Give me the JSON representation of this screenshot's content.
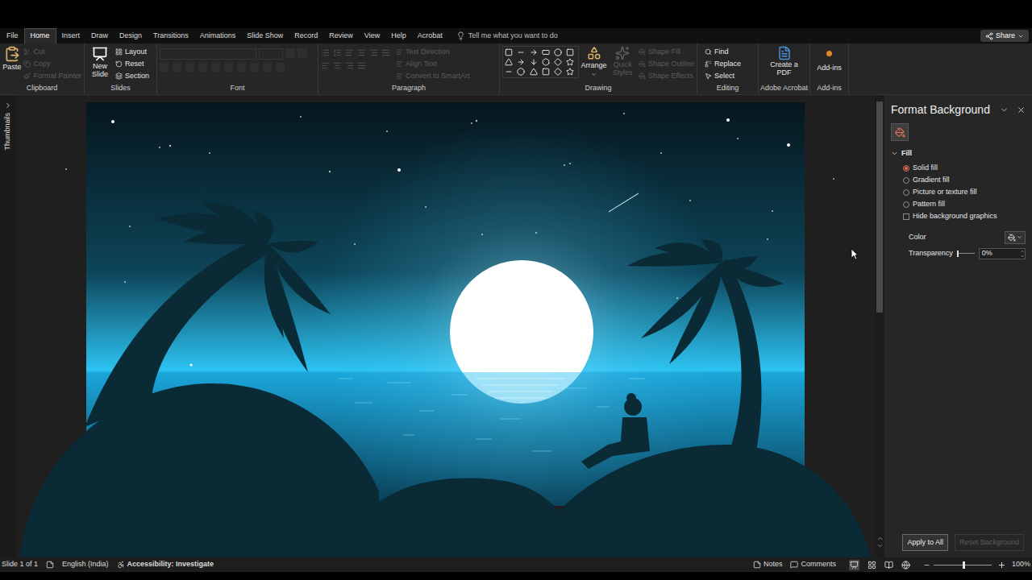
{
  "title_bar": {
    "share": "Share"
  },
  "tabs": [
    {
      "label": "File",
      "selected": false
    },
    {
      "label": "Home",
      "selected": true
    },
    {
      "label": "Insert",
      "selected": false
    },
    {
      "label": "Draw",
      "selected": false
    },
    {
      "label": "Design",
      "selected": false
    },
    {
      "label": "Transitions",
      "selected": false
    },
    {
      "label": "Animations",
      "selected": false
    },
    {
      "label": "Slide Show",
      "selected": false
    },
    {
      "label": "Record",
      "selected": false
    },
    {
      "label": "Review",
      "selected": false
    },
    {
      "label": "View",
      "selected": false
    },
    {
      "label": "Help",
      "selected": false
    },
    {
      "label": "Acrobat",
      "selected": false
    }
  ],
  "tell_me": "Tell me what you want to do",
  "ribbon": {
    "clipboard": {
      "label": "Clipboard",
      "paste": "Paste",
      "items": [
        {
          "label": "Cut",
          "disabled": true
        },
        {
          "label": "Copy",
          "disabled": true
        },
        {
          "label": "Format Painter",
          "disabled": true
        }
      ]
    },
    "slides": {
      "label": "Slides",
      "new_slide": "New Slide",
      "items": [
        "Layout",
        "Reset",
        "Section"
      ]
    },
    "font": {
      "label": "Font"
    },
    "paragraph": {
      "label": "Paragraph",
      "items": [
        {
          "label": "Text Direction",
          "disabled": true
        },
        {
          "label": "Align Text",
          "disabled": true
        },
        {
          "label": "Convert to SmartArt",
          "disabled": true
        }
      ]
    },
    "drawing": {
      "label": "Drawing",
      "arrange": "Arrange",
      "quick_styles": {
        "label": "Quick Styles",
        "disabled": true
      },
      "items": [
        {
          "label": "Shape Fill",
          "disabled": true
        },
        {
          "label": "Shape Outline",
          "disabled": true
        },
        {
          "label": "Shape Effects",
          "disabled": true
        }
      ]
    },
    "editing": {
      "label": "Editing",
      "items": [
        "Find",
        "Replace",
        "Select"
      ]
    },
    "acrobat": {
      "label": "Adobe Acrobat",
      "button": "Create a PDF"
    },
    "addins": {
      "label": "Add-ins",
      "button": "Add-ins"
    }
  },
  "thumbnails": {
    "label": "Thumbnails"
  },
  "pane": {
    "title": "Format Background",
    "section": "Fill",
    "expanded": true,
    "options": [
      {
        "label": "Solid fill",
        "selected": true
      },
      {
        "label": "Gradient fill",
        "selected": false
      },
      {
        "label": "Picture or texture fill",
        "selected": false
      },
      {
        "label": "Pattern fill",
        "selected": false
      }
    ],
    "hide_background_graphics": {
      "label": "Hide background graphics",
      "checked": false
    },
    "color": {
      "label": "Color"
    },
    "transparency": {
      "label": "Transparency",
      "value": "0%",
      "level": 0
    },
    "buttons": [
      {
        "label": "Apply to All",
        "disabled": false
      },
      {
        "label": "Reset Background",
        "disabled": true
      }
    ]
  },
  "status_bar": {
    "slide": "Slide 1 of 1",
    "language": "English (India)",
    "accessibility": "Accessibility: Investigate",
    "notes": "Notes",
    "comments": "Comments",
    "zoom": "100%",
    "zoom_level": 0.5
  }
}
